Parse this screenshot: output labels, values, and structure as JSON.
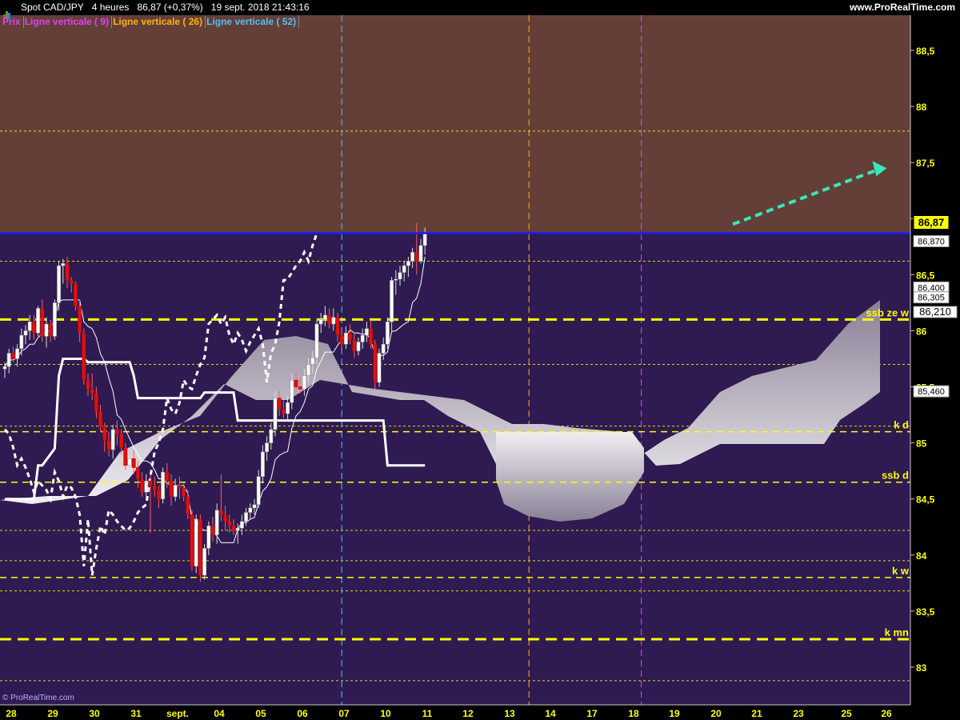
{
  "header": {
    "symbol": "Spot CAD/JPY",
    "timeframe": "4 heures",
    "last_price": "86,87 (+0,37%)",
    "datetime": "19 sept. 2018 21:43:16",
    "site": "www.ProRealTime.com",
    "copyright": "© ProRealTime.com"
  },
  "legend": [
    {
      "label": "Prix",
      "color": "#e040fb"
    },
    {
      "label": "Ligne verticale ( 9)",
      "color": "#e040fb"
    },
    {
      "label": "Ligne verticale ( 26)",
      "color": "#ffb300"
    },
    {
      "label": "Ligne verticale ( 52)",
      "color": "#4fc3f7"
    }
  ],
  "colors": {
    "zone_above": "#633f38",
    "zone_below": "#2f1a52",
    "current_price_line": "#1a1aff",
    "level_line": "#ffff00",
    "projection_arrow": "#38e8b8",
    "axis_bg": "#000000",
    "bull": "#ffffff",
    "bear": "#e01010"
  },
  "chart_data": {
    "type": "candlestick",
    "title": "Spot CAD/JPY",
    "ylim": [
      82.8,
      89.0
    ],
    "y_ticks": [
      83,
      83.5,
      84,
      84.5,
      85,
      85.5,
      86,
      86.5,
      87,
      87.5,
      88,
      88.5
    ],
    "y_tick_labels": [
      "83",
      "83,5",
      "84",
      "84,5",
      "85",
      "85,5",
      "86",
      "86,5",
      "87",
      "87,5",
      "88",
      "88,5"
    ],
    "x_labels": [
      "28",
      "29",
      "30",
      "31",
      "sept.",
      "04",
      "05",
      "06",
      "07",
      "10",
      "11",
      "12",
      "13",
      "14",
      "17",
      "18",
      "19",
      "20",
      "21",
      "23",
      "25",
      "26"
    ],
    "current_price": 86.87,
    "current_price_label": "86,87",
    "price_tags": [
      {
        "value": 86.87,
        "label": "86,870"
      },
      {
        "value": 86.4,
        "label": "86,400"
      },
      {
        "value": 86.305,
        "label": "86,305"
      },
      {
        "value": 86.21,
        "label": "86,210"
      },
      {
        "value": 85.46,
        "label": "85,460"
      }
    ],
    "levels": [
      {
        "value": 86.1,
        "label": "ssb ze w",
        "style": "dash-thick"
      },
      {
        "value": 85.1,
        "label": "k d",
        "style": "dash"
      },
      {
        "value": 84.65,
        "label": "ssb d",
        "style": "dash"
      },
      {
        "value": 83.8,
        "label": "k w",
        "style": "dash"
      },
      {
        "value": 83.25,
        "label": "k mn",
        "style": "dash-thick"
      }
    ],
    "dotted_levels": [
      87.78,
      86.62,
      85.7,
      85.15,
      84.22,
      83.95,
      83.68,
      82.88
    ],
    "vertical_lines": [
      {
        "label": "Ligne verticale ( 52)",
        "x_index": 81,
        "color": "#4fc3f7"
      },
      {
        "label": "Ligne verticale ( 26)",
        "x_index": 126,
        "color": "#ffb300"
      },
      {
        "label": "Ligne verticale ( 9)",
        "x_index": 153,
        "color": "#e040fb"
      }
    ],
    "ohlc": [
      [
        85.66,
        85.72,
        85.58,
        85.68
      ],
      [
        85.68,
        85.84,
        85.62,
        85.8
      ],
      [
        85.8,
        85.86,
        85.72,
        85.75
      ],
      [
        85.75,
        85.88,
        85.68,
        85.84
      ],
      [
        85.84,
        86.02,
        85.78,
        85.96
      ],
      [
        85.96,
        86.05,
        85.88,
        86.0
      ],
      [
        86.0,
        86.14,
        85.92,
        86.08
      ],
      [
        86.08,
        86.14,
        85.92,
        85.98
      ],
      [
        85.98,
        86.22,
        85.95,
        86.2
      ],
      [
        86.2,
        86.28,
        85.9,
        85.95
      ],
      [
        85.95,
        86.12,
        85.85,
        86.06
      ],
      [
        86.06,
        86.1,
        85.9,
        85.95
      ],
      [
        85.95,
        86.28,
        85.92,
        86.25
      ],
      [
        86.25,
        86.62,
        86.18,
        86.58
      ],
      [
        86.58,
        86.64,
        86.42,
        86.6
      ],
      [
        86.6,
        86.66,
        86.38,
        86.45
      ],
      [
        86.45,
        86.48,
        86.34,
        86.42
      ],
      [
        86.42,
        86.44,
        86.18,
        86.22
      ],
      [
        86.22,
        86.28,
        85.9,
        85.98
      ],
      [
        85.98,
        86.02,
        85.52,
        85.56
      ],
      [
        85.56,
        85.62,
        85.42,
        85.48
      ],
      [
        85.48,
        85.62,
        85.38,
        85.44
      ],
      [
        85.44,
        85.5,
        85.22,
        85.28
      ],
      [
        85.28,
        85.34,
        85.1,
        85.14
      ],
      [
        85.14,
        85.18,
        84.92,
        85.02
      ],
      [
        85.02,
        85.1,
        84.88,
        84.94
      ],
      [
        84.94,
        85.16,
        84.86,
        85.12
      ],
      [
        85.12,
        85.2,
        84.98,
        85.08
      ],
      [
        85.08,
        85.12,
        84.9,
        84.96
      ],
      [
        84.96,
        85.0,
        84.76,
        84.8
      ],
      [
        84.8,
        84.9,
        84.72,
        84.86
      ],
      [
        84.86,
        84.94,
        84.72,
        84.78
      ],
      [
        84.78,
        84.84,
        84.6,
        84.68
      ],
      [
        84.68,
        84.74,
        84.52,
        84.56
      ],
      [
        84.56,
        84.72,
        84.5,
        84.66
      ],
      [
        84.66,
        84.72,
        84.2,
        84.62
      ],
      [
        84.62,
        84.7,
        84.52,
        84.58
      ],
      [
        84.58,
        84.62,
        84.42,
        84.5
      ],
      [
        84.5,
        84.78,
        84.46,
        84.74
      ],
      [
        84.74,
        84.82,
        84.6,
        84.66
      ],
      [
        84.66,
        84.72,
        84.44,
        84.52
      ],
      [
        84.52,
        84.68,
        84.48,
        84.62
      ],
      [
        84.62,
        84.7,
        84.5,
        84.6
      ],
      [
        84.6,
        84.64,
        84.48,
        84.52
      ],
      [
        84.52,
        84.58,
        84.32,
        84.36
      ],
      [
        84.36,
        84.4,
        83.86,
        83.9
      ],
      [
        83.9,
        84.36,
        83.84,
        84.32
      ],
      [
        84.32,
        84.36,
        83.76,
        83.82
      ],
      [
        83.82,
        84.1,
        83.78,
        84.06
      ],
      [
        84.06,
        84.3,
        84.0,
        84.26
      ],
      [
        84.26,
        84.34,
        84.12,
        84.18
      ],
      [
        84.18,
        84.46,
        84.1,
        84.4
      ],
      [
        84.4,
        84.72,
        84.3,
        84.36
      ],
      [
        84.36,
        84.44,
        84.22,
        84.3
      ],
      [
        84.3,
        84.36,
        84.2,
        84.26
      ],
      [
        84.26,
        84.32,
        84.18,
        84.22
      ],
      [
        84.22,
        84.28,
        84.1,
        84.24
      ],
      [
        84.24,
        84.36,
        84.18,
        84.3
      ],
      [
        84.3,
        84.42,
        84.26,
        84.38
      ],
      [
        84.38,
        84.46,
        84.32,
        84.42
      ],
      [
        84.42,
        84.5,
        84.36,
        84.45
      ],
      [
        84.45,
        84.76,
        84.42,
        84.7
      ],
      [
        84.7,
        84.98,
        84.64,
        84.92
      ],
      [
        84.92,
        85.06,
        84.84,
        85.0
      ],
      [
        85.0,
        85.18,
        84.94,
        85.12
      ],
      [
        85.12,
        85.46,
        85.06,
        85.4
      ],
      [
        85.4,
        85.46,
        85.24,
        85.3
      ],
      [
        85.3,
        85.38,
        85.22,
        85.26
      ],
      [
        85.26,
        85.42,
        85.2,
        85.36
      ],
      [
        85.36,
        85.62,
        85.3,
        85.56
      ],
      [
        85.56,
        85.62,
        85.42,
        85.5
      ],
      [
        85.5,
        85.58,
        85.44,
        85.48
      ],
      [
        85.48,
        85.66,
        85.42,
        85.6
      ],
      [
        85.6,
        85.76,
        85.54,
        85.7
      ],
      [
        85.7,
        85.82,
        85.62,
        85.76
      ],
      [
        85.76,
        86.1,
        85.7,
        86.06
      ],
      [
        86.06,
        86.16,
        85.98,
        86.1
      ],
      [
        86.1,
        86.22,
        86.04,
        86.14
      ],
      [
        86.14,
        86.2,
        86.02,
        86.06
      ],
      [
        86.06,
        86.2,
        86.0,
        86.12
      ],
      [
        86.12,
        86.16,
        85.9,
        85.96
      ],
      [
        85.96,
        86.02,
        85.82,
        85.88
      ],
      [
        85.88,
        86.04,
        85.84,
        85.98
      ],
      [
        85.98,
        86.06,
        85.88,
        85.92
      ],
      [
        85.92,
        85.98,
        85.76,
        85.82
      ],
      [
        85.82,
        85.94,
        85.78,
        85.9
      ],
      [
        85.9,
        86.02,
        85.84,
        85.96
      ],
      [
        85.96,
        86.08,
        85.9,
        86.02
      ],
      [
        86.02,
        86.1,
        85.84,
        85.88
      ],
      [
        85.88,
        85.92,
        85.48,
        85.54
      ],
      [
        85.54,
        85.84,
        85.5,
        85.8
      ],
      [
        85.8,
        85.94,
        85.74,
        85.88
      ],
      [
        85.88,
        86.12,
        85.84,
        86.08
      ],
      [
        86.08,
        86.48,
        86.0,
        86.45
      ],
      [
        86.45,
        86.54,
        86.32,
        86.46
      ],
      [
        86.46,
        86.58,
        86.4,
        86.52
      ],
      [
        86.52,
        86.62,
        86.44,
        86.58
      ],
      [
        86.58,
        86.66,
        86.48,
        86.62
      ],
      [
        86.62,
        86.74,
        86.56,
        86.7
      ],
      [
        86.7,
        86.96,
        86.5,
        86.62
      ],
      [
        86.62,
        86.82,
        86.6,
        86.76
      ],
      [
        86.76,
        86.92,
        86.68,
        86.87
      ]
    ],
    "kijun_line": [
      [
        84.5,
        84.5,
        84.5,
        84.5,
        84.5,
        84.5,
        84.5,
        84.5,
        84.8,
        84.8,
        84.85,
        84.9,
        84.95,
        85.6,
        85.75,
        85.75,
        85.75,
        85.75,
        85.75,
        85.75,
        85.72,
        85.72,
        85.72,
        85.72,
        85.72,
        85.72,
        85.72,
        85.72,
        85.72,
        85.72,
        85.72,
        85.6,
        85.4,
        85.4,
        85.4,
        85.4,
        85.4,
        85.4,
        85.4,
        85.4,
        85.4,
        85.4,
        85.4,
        85.4,
        85.4,
        85.4,
        85.4,
        85.4,
        85.45,
        85.45,
        85.45,
        85.45,
        85.45,
        85.45,
        85.45,
        85.45,
        85.2,
        85.2,
        85.2,
        85.2,
        85.2,
        85.2,
        85.2,
        85.2,
        85.2,
        85.2,
        85.2,
        85.2,
        85.2,
        85.2,
        85.2,
        85.2,
        85.2,
        85.2,
        85.2,
        85.2,
        85.2,
        85.2,
        85.2,
        85.2,
        85.2,
        85.2,
        85.2,
        85.2,
        85.2,
        85.2,
        85.2,
        85.2,
        85.2,
        85.2,
        85.2,
        85.2,
        84.8,
        84.8,
        84.8,
        84.8,
        84.8,
        84.8,
        84.8,
        84.8,
        84.8,
        84.8
      ]
    ],
    "projection": {
      "from_price": 86.95,
      "to_price": 87.45,
      "from_index": 175,
      "to_index": 212
    }
  }
}
